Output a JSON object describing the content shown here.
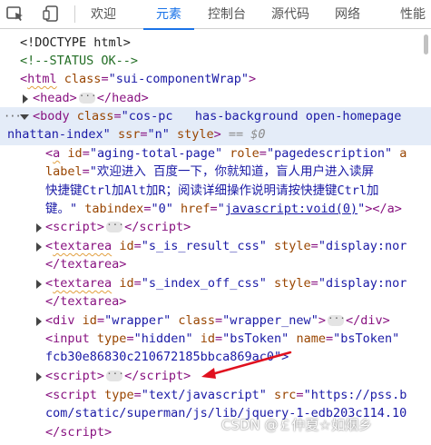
{
  "toolbar": {
    "tabs": [
      {
        "label": "欢迎"
      },
      {
        "label": "元素"
      },
      {
        "label": "控制台"
      },
      {
        "label": "源代码"
      },
      {
        "label": "网络"
      },
      {
        "label": "性能"
      }
    ],
    "active_tab": "元素",
    "accent_color": "#1a73e8"
  },
  "dom": {
    "doctype": "<!DOCTYPE html>",
    "comment": "<!--STATUS OK-->",
    "html_tag": "html",
    "html_class_attr": "class",
    "html_class_val": "\"sui-componentWrap\"",
    "head_tag": "head",
    "body_tag": "body",
    "body_class_attr": "class",
    "body_class_val_1": "\"cos-pc   has-background open-homepage ",
    "body_class_val_2": "nhattan-index\"",
    "body_ssr_attr": "ssr",
    "body_ssr_val": "\"n\"",
    "body_style_attr": "style",
    "body_dollar": "== $0",
    "a_tag": "a",
    "a_id_attr": "id",
    "a_id_val": "\"aging-total-page\"",
    "a_role_attr": "role",
    "a_role_val": "\"pagedescription\"",
    "a_role_tail": "a",
    "a_label_attr": "label",
    "a_label_val_1": "\"欢迎进入 百度一下，你就知道，盲人用户进入读屏",
    "a_label_val_2": "快捷键Ctrl加Alt加R；阅读详细操作说明请按快捷键Ctrl加",
    "a_label_val_3": "键。\"",
    "a_tabindex_attr": "tabindex",
    "a_tabindex_val": "\"0\"",
    "a_href_attr": "href",
    "a_href_val": "javascript:void(0)",
    "script_tag": "script",
    "textarea_tag": "textarea",
    "ta1_id_attr": "id",
    "ta1_id_val": "\"s_is_result_css\"",
    "ta1_style_attr": "style",
    "ta1_style_val": "\"display:nor",
    "ta2_id_attr": "id",
    "ta2_id_val": "\"s_index_off_css\"",
    "ta2_style_attr": "style",
    "ta2_style_val": "\"display:nor",
    "div_tag": "div",
    "div_id_attr": "id",
    "div_id_val": "\"wrapper\"",
    "div_class_attr": "class",
    "div_class_val": "\"wrapper_new\"",
    "input_tag": "input",
    "input_type_attr": "type",
    "input_type_val": "\"hidden\"",
    "input_id_attr": "id",
    "input_id_val": "\"bsToken\"",
    "input_name_attr": "name",
    "input_name_val": "\"bsToken\"",
    "input_value_tail": "fcb30e86830c210672185bbca869ac0\">",
    "script2_type_attr": "type",
    "script2_type_val": "\"text/javascript\"",
    "script2_src_attr": "src",
    "script2_src_val_1": "\"https://pss.b",
    "script2_src_val_2": "com/static/superman/js/lib/jquery-1-edb203c114.10"
  },
  "watermark_text": "CSDN @￡仲夏☆如烟乡",
  "annotation_color": "#e0101e",
  "selection_color": "#e4ecf8"
}
